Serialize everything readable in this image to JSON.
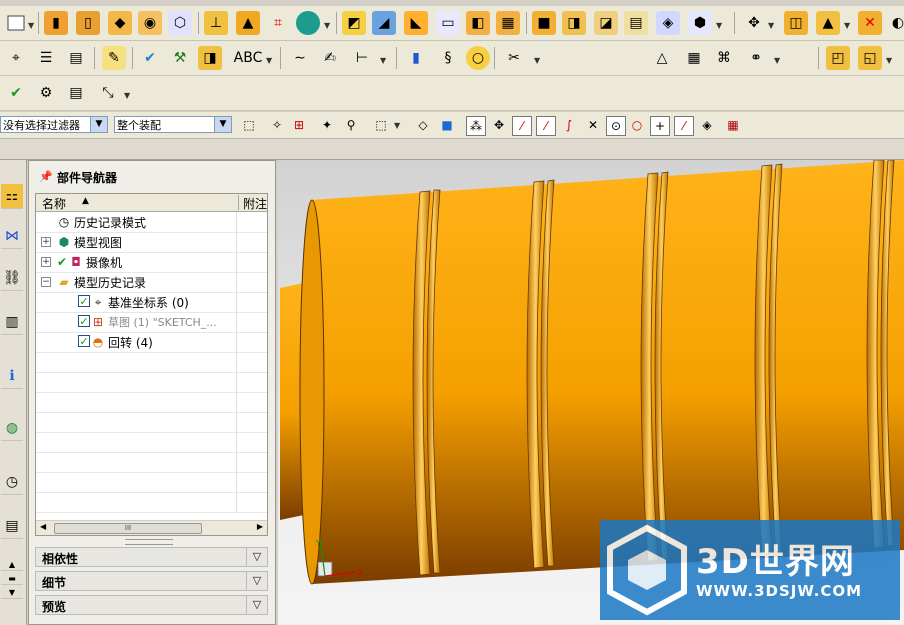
{
  "selection_bar": {
    "filter_value": "没有选择过滤器",
    "scope_value": "整个装配"
  },
  "navigator": {
    "title": "部件导航器",
    "columns": {
      "name": "名称",
      "note": "附注"
    },
    "rows": [
      {
        "label": "历史记录模式",
        "expander": "",
        "checked": false,
        "dim": false
      },
      {
        "label": "模型视图",
        "expander": "+",
        "checked": false,
        "dim": false
      },
      {
        "label": "摄像机",
        "expander": "+",
        "checked": false,
        "dim": false
      },
      {
        "label": "模型历史记录",
        "expander": "−",
        "checked": false,
        "dim": false
      },
      {
        "label": "基准坐标系 (0)",
        "expander": "",
        "checked": true,
        "dim": false
      },
      {
        "label": "草图 (1) \"SKETCH_...",
        "expander": "",
        "checked": true,
        "dim": true
      },
      {
        "label": "回转 (4)",
        "expander": "",
        "checked": true,
        "dim": false
      }
    ],
    "scroll_thumb": "III",
    "panels": {
      "dependencies": "相依性",
      "details": "细节",
      "preview": "预览"
    }
  },
  "icons": {
    "nav_title": "pin-icon",
    "history_mode": "clock-icon",
    "model_views": "cube-icon",
    "camera": "camera-icon",
    "model_history": "folder-icon",
    "datum_csys": "csys-icon",
    "sketch": "sketch-icon",
    "revolve": "revolve-icon"
  },
  "viewport": {
    "watermark_title": "3D世界网",
    "watermark_url": "WWW.3DSJW.COM",
    "part_color": "#f5a800",
    "accent_color": "#1b78c6"
  }
}
